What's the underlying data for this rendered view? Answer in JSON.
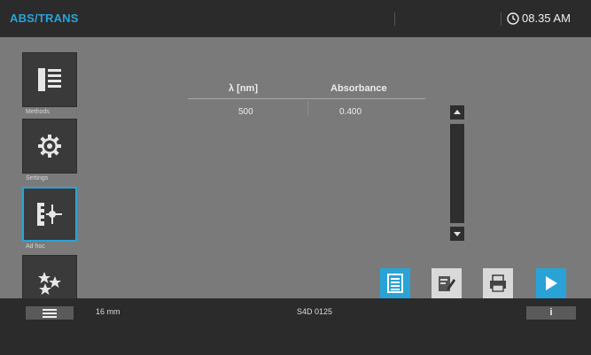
{
  "header": {
    "app_title": "ABS/TRANS",
    "time": "08.35 AM"
  },
  "sidebar": {
    "items": [
      {
        "label": "Methods",
        "icon": "methods-list-icon"
      },
      {
        "label": "Settings",
        "icon": "gear-icon"
      },
      {
        "label": "Ad hoc",
        "icon": "ad-hoc-scan-icon"
      },
      {
        "label": "",
        "icon": "favorites-icon"
      }
    ],
    "active_index": 2
  },
  "table": {
    "columns": [
      "λ [nm]",
      "Absorbance"
    ],
    "rows": [
      [
        "500",
        "0.400"
      ]
    ]
  },
  "actions": {
    "buttons": [
      {
        "icon": "save-list-icon",
        "color": "#29a3d6"
      },
      {
        "icon": "edit-icon",
        "color": "#d9d9d9"
      },
      {
        "icon": "print-icon",
        "color": "#d9d9d9"
      },
      {
        "icon": "play-icon",
        "color": "#29a3d6"
      }
    ]
  },
  "status": {
    "cuvette": "16 mm",
    "serial": "S4D 0125",
    "info_label": "i"
  },
  "colors": {
    "accent": "#29a3d6",
    "background": "#7a7a7a",
    "bar": "#2b2b2b"
  }
}
